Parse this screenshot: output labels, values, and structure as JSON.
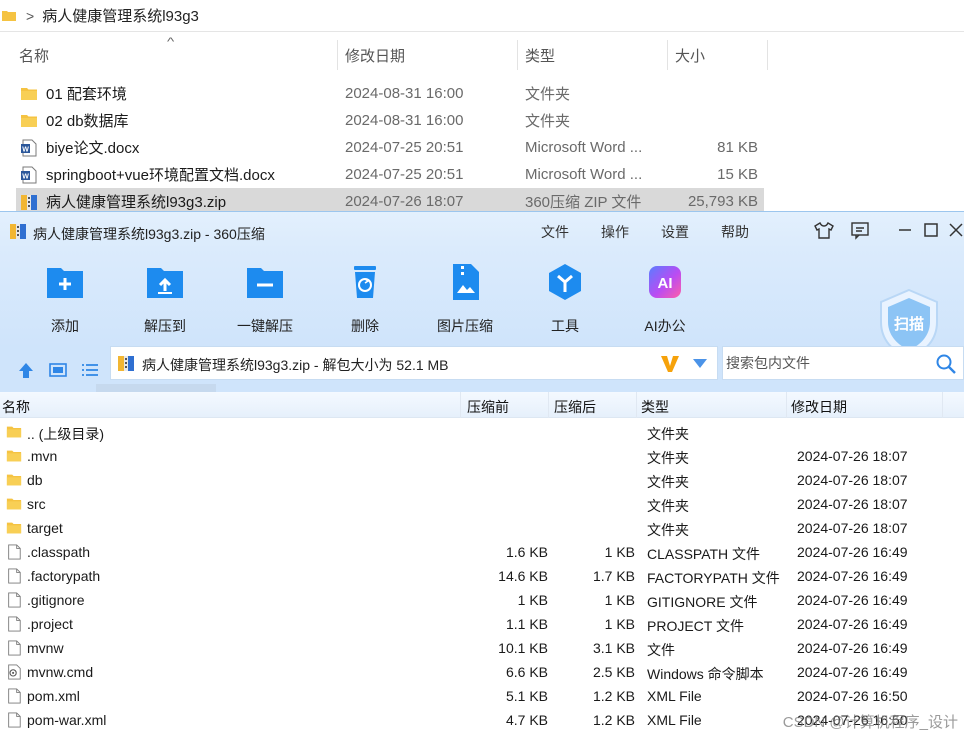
{
  "explorer": {
    "breadcrumb_separator": ">",
    "path": "病人健康管理系统l93g3",
    "columns": {
      "name": "名称",
      "modified": "修改日期",
      "type": "类型",
      "size": "大小"
    },
    "files": [
      {
        "name": "01 配套环境",
        "modified": "2024-08-31 16:00",
        "type": "文件夹",
        "size": "",
        "icon": "folder-icon"
      },
      {
        "name": "02 db数据库",
        "modified": "2024-08-31 16:00",
        "type": "文件夹",
        "size": "",
        "icon": "folder-icon"
      },
      {
        "name": "biye论文.docx",
        "modified": "2024-07-25 20:51",
        "type": "Microsoft Word ...",
        "size": "81 KB",
        "icon": "word-doc-icon"
      },
      {
        "name": "springboot+vue环境配置文档.docx",
        "modified": "2024-07-25 20:51",
        "type": "Microsoft Word ...",
        "size": "15 KB",
        "icon": "word-doc-icon"
      },
      {
        "name": "病人健康管理系统l93g3.zip",
        "modified": "2024-07-26 18:07",
        "type": "360压缩 ZIP 文件",
        "size": "25,793 KB",
        "icon": "zip-archive-icon",
        "selected": true
      }
    ]
  },
  "zip": {
    "title": "病人健康管理系统l93g3.zip - 360压缩",
    "menu": [
      "文件",
      "操作",
      "设置",
      "帮助"
    ],
    "toolbar": [
      {
        "label": "添加",
        "icon": "add-file-icon"
      },
      {
        "label": "解压到",
        "icon": "extract-to-icon"
      },
      {
        "label": "一键解压",
        "icon": "one-click-extract-icon"
      },
      {
        "label": "删除",
        "icon": "recycle-bin-icon"
      },
      {
        "label": "图片压缩",
        "icon": "image-compress-icon"
      },
      {
        "label": "工具",
        "icon": "tools-icon"
      },
      {
        "label": "AI办公",
        "icon": "ai-office-icon"
      }
    ],
    "scan_label": "扫描",
    "ai_badge": "AI",
    "path_text": "病人健康管理系统l93g3.zip - 解包大小为 52.1 MB",
    "search_placeholder": "搜索包内文件",
    "columns": {
      "name": "名称",
      "before": "压缩前",
      "after": "压缩后",
      "type": "类型",
      "modified": "修改日期"
    },
    "rows": [
      {
        "name": ".. (上级目录)",
        "before": "",
        "after": "",
        "type": "文件夹",
        "modified": "",
        "icon": "folder-icon"
      },
      {
        "name": ".mvn",
        "before": "",
        "after": "",
        "type": "文件夹",
        "modified": "2024-07-26 18:07",
        "icon": "folder-icon"
      },
      {
        "name": "db",
        "before": "",
        "after": "",
        "type": "文件夹",
        "modified": "2024-07-26 18:07",
        "icon": "folder-icon"
      },
      {
        "name": "src",
        "before": "",
        "after": "",
        "type": "文件夹",
        "modified": "2024-07-26 18:07",
        "icon": "folder-icon"
      },
      {
        "name": "target",
        "before": "",
        "after": "",
        "type": "文件夹",
        "modified": "2024-07-26 18:07",
        "icon": "folder-icon"
      },
      {
        "name": ".classpath",
        "before": "1.6 KB",
        "after": "1 KB",
        "type": "CLASSPATH 文件",
        "modified": "2024-07-26 16:49",
        "icon": "file-icon"
      },
      {
        "name": ".factorypath",
        "before": "14.6 KB",
        "after": "1.7 KB",
        "type": "FACTORYPATH 文件",
        "modified": "2024-07-26 16:49",
        "icon": "file-icon"
      },
      {
        "name": ".gitignore",
        "before": "1 KB",
        "after": "1 KB",
        "type": "GITIGNORE 文件",
        "modified": "2024-07-26 16:49",
        "icon": "file-icon"
      },
      {
        "name": ".project",
        "before": "1.1 KB",
        "after": "1 KB",
        "type": "PROJECT 文件",
        "modified": "2024-07-26 16:49",
        "icon": "file-icon"
      },
      {
        "name": "mvnw",
        "before": "10.1 KB",
        "after": "3.1 KB",
        "type": "文件",
        "modified": "2024-07-26 16:49",
        "icon": "file-icon"
      },
      {
        "name": "mvnw.cmd",
        "before": "6.6 KB",
        "after": "2.5 KB",
        "type": "Windows 命令脚本",
        "modified": "2024-07-26 16:49",
        "icon": "cmd-script-icon"
      },
      {
        "name": "pom.xml",
        "before": "5.1 KB",
        "after": "1.2 KB",
        "type": "XML File",
        "modified": "2024-07-26 16:50",
        "icon": "file-icon"
      },
      {
        "name": "pom-war.xml",
        "before": "4.7 KB",
        "after": "1.2 KB",
        "type": "XML File",
        "modified": "2024-07-26 16:50",
        "icon": "file-icon"
      }
    ]
  },
  "watermark": "CSDN @计算机程序_设计",
  "colors": {
    "accent": "#1d8bef",
    "selection": "#d9d9d9",
    "toolbar_bg": "#d6e8fc",
    "folder": "#f5c342"
  }
}
